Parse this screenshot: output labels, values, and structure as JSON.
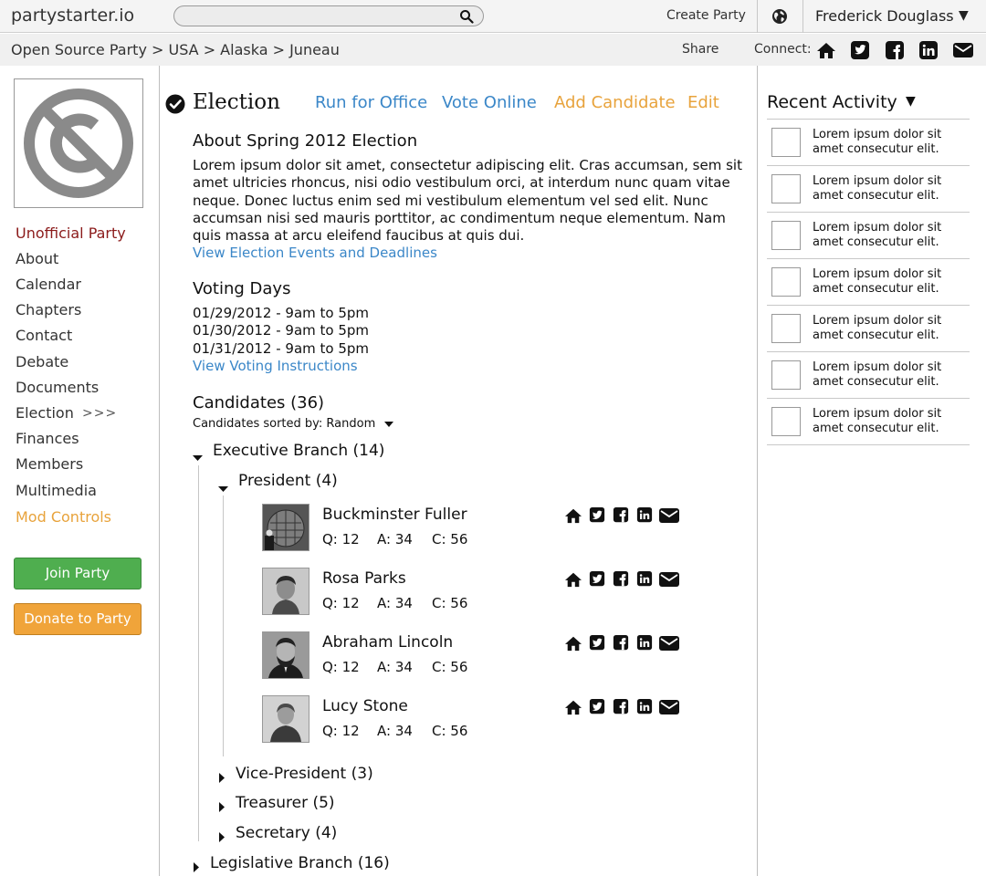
{
  "topbar": {
    "logo": "partystarter.io",
    "search_placeholder": "",
    "create_party": "Create Party",
    "user_name": "Frederick Douglass",
    "user_caret": "▼"
  },
  "breadcrumb": {
    "text": "Open Source Party > USA > Alaska > Juneau",
    "share": "Share",
    "connect": "Connect:",
    "connect_icons": [
      "home-icon",
      "twitter-icon",
      "facebook-icon",
      "linkedin-icon",
      "email-icon"
    ]
  },
  "sidebar": {
    "items": [
      "Unofficial Party",
      "About",
      "Calendar",
      "Chapters",
      "Contact",
      "Debate",
      "Documents",
      "Election",
      "Finances",
      "Members",
      "Multimedia",
      "Mod Controls"
    ],
    "active_marker": ">>>",
    "join_button": "Join Party",
    "donate_button": "Donate to Party"
  },
  "main": {
    "title": "Election",
    "actions": [
      "Run for Office",
      "Vote Online",
      "Add Candidate",
      "Edit"
    ],
    "about_heading": "About Spring 2012 Election",
    "about_text": [
      "Lorem ipsum dolor sit amet, consectetur adipiscing elit. Cras accumsan, sem sit",
      "amet ultricies rhoncus, nisi odio vestibulum orci, at interdum nunc quam vitae",
      "neque. Donec luctus enim sed mi vestibulum elementum vel sed elit. Nunc",
      "accumsan nisi sed mauris porttitor, ac condimentum neque elementum. Nam",
      "quis massa at arcu eleifend faucibus at quis dui."
    ],
    "about_link": "View Election Events and Deadlines",
    "voting_heading": "Voting Days",
    "voting_days": [
      "01/29/2012 - 9am to 5pm",
      "01/30/2012 - 9am to 5pm",
      "01/31/2012 - 9am to 5pm"
    ],
    "voting_link": "View Voting Instructions",
    "candidates_heading": "Candidates (36)",
    "sort_label": "Candidates sorted by: Random",
    "tree": {
      "executive": "Executive Branch (14)",
      "president": "President (4)",
      "candidates": [
        {
          "name": "Buckminster Fuller",
          "q": "Q: 12",
          "a": "A: 34",
          "c": "C: 56"
        },
        {
          "name": "Rosa Parks",
          "q": "Q: 12",
          "a": "A: 34",
          "c": "C: 56"
        },
        {
          "name": "Abraham Lincoln",
          "q": "Q: 12",
          "a": "A: 34",
          "c": "C: 56"
        },
        {
          "name": "Lucy Stone",
          "q": "Q: 12",
          "a": "A: 34",
          "c": "C: 56"
        }
      ],
      "vice_president": "Vice-President (3)",
      "treasurer": "Treasurer (5)",
      "secretary": "Secretary (4)",
      "legislative": "Legislative Branch (16)"
    }
  },
  "activity": {
    "title": "Recent Activity",
    "caret": "▼",
    "items": [
      [
        "Lorem ipsum dolor sit",
        "amet consecutur elit."
      ],
      [
        "Lorem ipsum dolor sit",
        "amet consecutur elit."
      ],
      [
        "Lorem ipsum dolor sit",
        "amet consecutur elit."
      ],
      [
        "Lorem ipsum dolor sit",
        "amet consecutur elit."
      ],
      [
        "Lorem ipsum dolor sit",
        "amet consecutur elit."
      ],
      [
        "Lorem ipsum dolor sit",
        "amet consecutur elit."
      ],
      [
        "Lorem ipsum dolor sit",
        "amet consecutur elit."
      ]
    ]
  }
}
